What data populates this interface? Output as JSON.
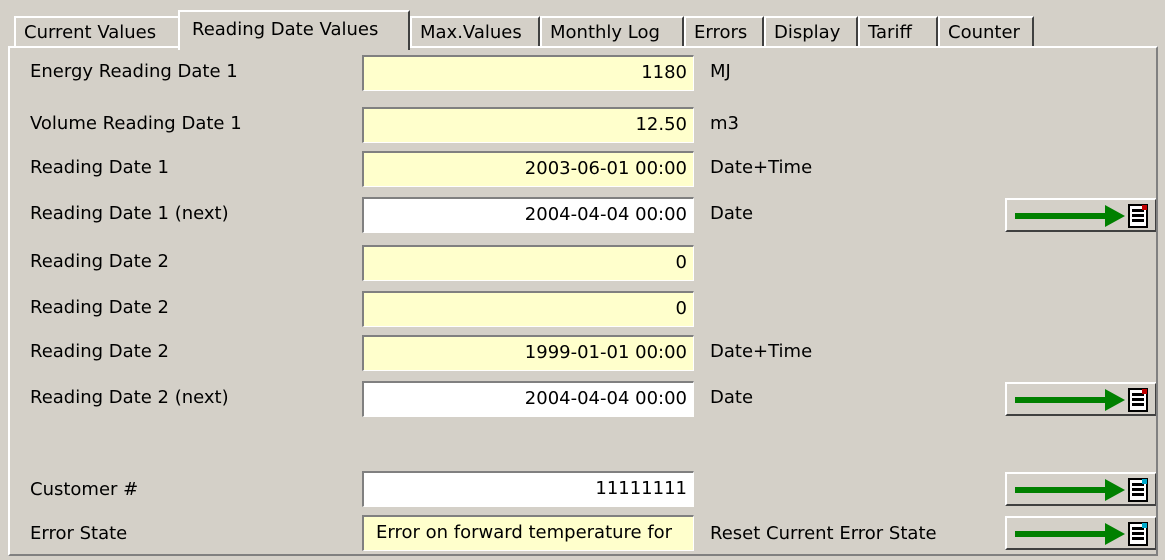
{
  "tabs": [
    {
      "label": "Current Values"
    },
    {
      "label": "Reading Date Values"
    },
    {
      "label": "Max.Values"
    },
    {
      "label": "Monthly Log"
    },
    {
      "label": "Errors"
    },
    {
      "label": "Display"
    },
    {
      "label": "Tariff"
    },
    {
      "label": "Counter"
    }
  ],
  "active_tab": "Reading Date Values",
  "rows": [
    {
      "label": "Energy Reading Date 1",
      "value": "1180",
      "unit": "MJ",
      "editable": false
    },
    {
      "label": "Volume Reading Date 1",
      "value": "12.50",
      "unit": "m3",
      "editable": false
    },
    {
      "label": "Reading Date 1",
      "value": "2003-06-01 00:00",
      "unit": "Date+Time",
      "editable": false
    },
    {
      "label": "Reading Date 1 (next)",
      "value": "2004-04-04 00:00",
      "unit": "Date",
      "editable": true
    },
    {
      "label": "Reading Date 2",
      "value": "0",
      "unit": "",
      "editable": false
    },
    {
      "label": "Reading Date 2",
      "value": "0",
      "unit": "",
      "editable": false
    },
    {
      "label": "Reading Date 2",
      "value": "1999-01-01 00:00",
      "unit": "Date+Time",
      "editable": false
    },
    {
      "label": "Reading Date 2 (next)",
      "value": "2004-04-04 00:00",
      "unit": "Date",
      "editable": true
    },
    {
      "label": "Customer #",
      "value": "11111111",
      "unit": "",
      "editable": true
    },
    {
      "label": "Error State",
      "value": "Error on forward temperature for",
      "unit": "Reset Current Error State",
      "editable": false
    }
  ],
  "colors": {
    "field_readonly": "#ffffcc",
    "field_editable": "#ffffff",
    "arrow": "#008000",
    "window_bg": "#d4d0c8"
  },
  "icons": {
    "write_button": "green-arrow-write-icon"
  }
}
